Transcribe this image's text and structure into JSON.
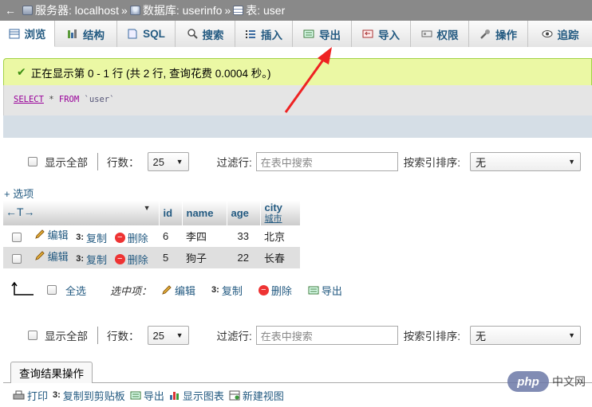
{
  "breadcrumb": {
    "server": "服务器: localhost",
    "database": "数据库: userinfo",
    "table": "表: user"
  },
  "tabs": [
    {
      "label": "浏览",
      "icon": "browse-icon"
    },
    {
      "label": "结构",
      "icon": "structure-icon"
    },
    {
      "label": "SQL",
      "icon": "sql-icon"
    },
    {
      "label": "搜索",
      "icon": "search-icon"
    },
    {
      "label": "插入",
      "icon": "insert-icon"
    },
    {
      "label": "导出",
      "icon": "export-icon"
    },
    {
      "label": "导入",
      "icon": "import-icon"
    },
    {
      "label": "权限",
      "icon": "privileges-icon"
    },
    {
      "label": "操作",
      "icon": "wrench-icon"
    },
    {
      "label": "追踪",
      "icon": "eye-icon"
    }
  ],
  "message": "正在显示第 0 - 1 行 (共 2 行, 查询花费 0.0004 秒。)",
  "sql": {
    "keyword1": "SELECT",
    "star": " * ",
    "keyword2": "FROM",
    "table": " `user`"
  },
  "nav": {
    "show_all": "显示全部",
    "rows_label": "行数：",
    "rows_value": "25",
    "filter_label": "过滤行:",
    "filter_placeholder": "在表中搜索",
    "sort_label": "按索引排序:",
    "sort_value": "无"
  },
  "options_link": "+ 选项",
  "table": {
    "arrows": "←T→",
    "columns": [
      {
        "name": "id"
      },
      {
        "name": "name"
      },
      {
        "name": "age"
      },
      {
        "name": "city",
        "sub": "城市"
      }
    ],
    "row_actions": {
      "edit": "编辑",
      "copy": "复制",
      "delete": "删除"
    },
    "rows": [
      {
        "id": "6",
        "name": "李四",
        "age": "33",
        "city": "北京"
      },
      {
        "id": "5",
        "name": "狗子",
        "age": "22",
        "city": "长春"
      }
    ]
  },
  "with_selected": {
    "check_all": "全选",
    "label": "选中项：",
    "edit": "编辑",
    "copy": "复制",
    "delete": "删除",
    "export": "导出"
  },
  "query_ops": {
    "title": "查询结果操作",
    "print": "打印",
    "copy_clipboard": "复制到剪贴板",
    "export": "导出",
    "show_chart": "显示图表",
    "create_view": "新建视图"
  },
  "watermark": {
    "logo": "php",
    "site": "中文网"
  },
  "colors": {
    "link": "#235a81",
    "success_bg": "#ebf8a4",
    "annotation_arrow": "#ee2222"
  }
}
